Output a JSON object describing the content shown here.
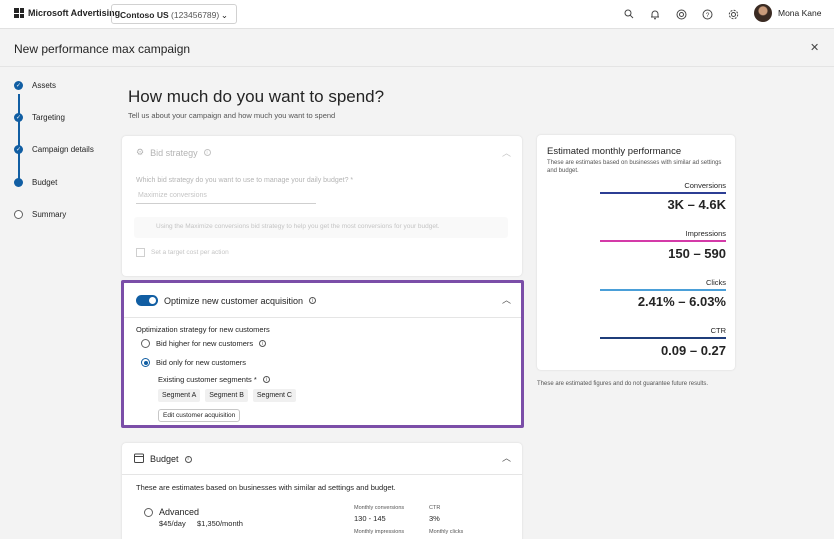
{
  "topbar": {
    "brand": "Microsoft Advertising",
    "account_name": "Contoso US",
    "account_id": "(123456789)",
    "user_name": "Mona Kane",
    "icons": [
      "search-icon",
      "bell-icon",
      "help-circle-icon",
      "question-icon",
      "gear-icon"
    ]
  },
  "page": {
    "title": "New performance max campaign"
  },
  "nav": {
    "steps": [
      {
        "label": "Assets",
        "state": "done"
      },
      {
        "label": "Targeting",
        "state": "done"
      },
      {
        "label": "Campaign details",
        "state": "done"
      },
      {
        "label": "Budget",
        "state": "current"
      },
      {
        "label": "Summary",
        "state": "todo"
      }
    ]
  },
  "main": {
    "title": "How much do you want to spend?",
    "subtitle": "Tell us about your campaign and how much you want to spend"
  },
  "bid_strategy": {
    "title": "Bid strategy",
    "question": "Which bid strategy do you want to use to manage your daily budget? *",
    "dropdown_value": "Maximize conversions",
    "info_text": "Using the Maximize conversions bid strategy to help you get the most conversions for your budget.",
    "target_label": "Set a target cost per action"
  },
  "customer_acquisition": {
    "title": "Optimize new customer acquisition",
    "strategy_label": "Optimization strategy for new customers",
    "options": [
      "Bid higher for new customers",
      "Bid only for new customers"
    ],
    "selected_index": 1,
    "segments_label": "Existing customer segments *",
    "segments": [
      "Segment A",
      "Segment B",
      "Segment C"
    ],
    "edit_button": "Edit customer acquisition"
  },
  "budget": {
    "title": "Budget",
    "description": "These are estimates based on businesses with similar ad settings and budget.",
    "option_name": "Advanced",
    "daily": "$45/day",
    "monthly": "$1,350/month",
    "stats": [
      {
        "label": "Monthly conversions",
        "value": "130 - 145"
      },
      {
        "label": "CTR",
        "value": "3%"
      },
      {
        "label": "Monthly impressions",
        "value": ""
      },
      {
        "label": "Monthly clicks",
        "value": ""
      }
    ]
  },
  "performance": {
    "title": "Estimated monthly performance",
    "description": "These are estimates based on businesses with similar ad settings and budget.",
    "metrics": [
      {
        "label": "Conversions",
        "value": "3K – 4.6K",
        "color": "#2c3e94"
      },
      {
        "label": "Impressions",
        "value": "150 – 590",
        "color": "#d43aa8"
      },
      {
        "label": "Clicks",
        "value": "2.41% – 6.03%",
        "color": "#4a9fd8"
      },
      {
        "label": "CTR",
        "value": "0.09 – 0.27",
        "color": "#1f3d7a"
      }
    ],
    "disclaimer": "These are estimated figures and do not guarantee future results."
  },
  "colors": {
    "accent": "#115ea3",
    "highlight": "#7b4ea8"
  }
}
